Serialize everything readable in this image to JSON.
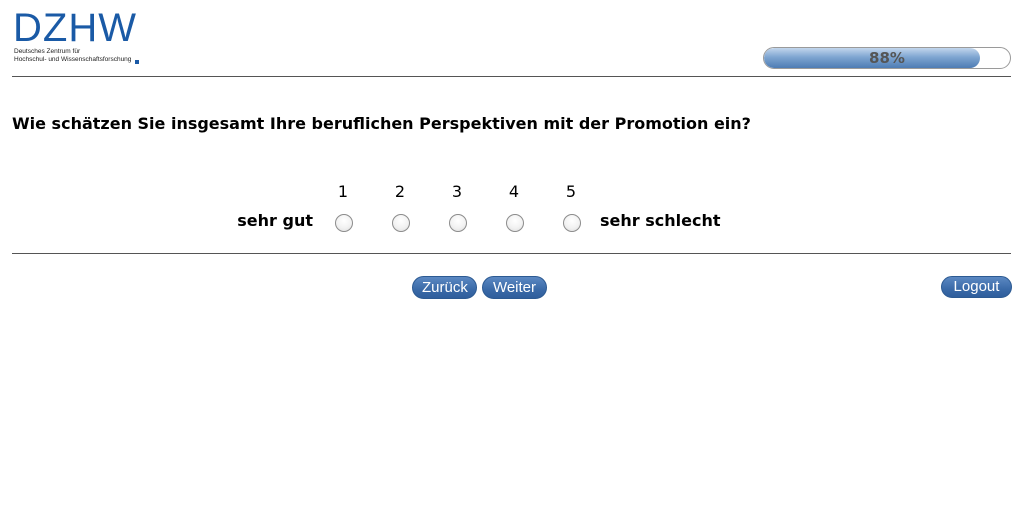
{
  "logo": {
    "wordmark": "DZHW",
    "line1": "Deutsches Zentrum für",
    "line2": "Hochschul- und Wissenschaftsforschung",
    "color": "#1a5aa6"
  },
  "progress": {
    "value_percent": 88,
    "label": "88%"
  },
  "question": {
    "text": "Wie schätzen Sie insgesamt Ihre beruflichen Perspektiven mit der Promotion ein?"
  },
  "scale": {
    "left_anchor": "sehr gut",
    "right_anchor": "sehr schlecht",
    "options": [
      "1",
      "2",
      "3",
      "4",
      "5"
    ]
  },
  "navigation": {
    "back_label": "Zurück",
    "next_label": "Weiter",
    "logout_label": "Logout",
    "button_color": "#3a6aa8"
  }
}
